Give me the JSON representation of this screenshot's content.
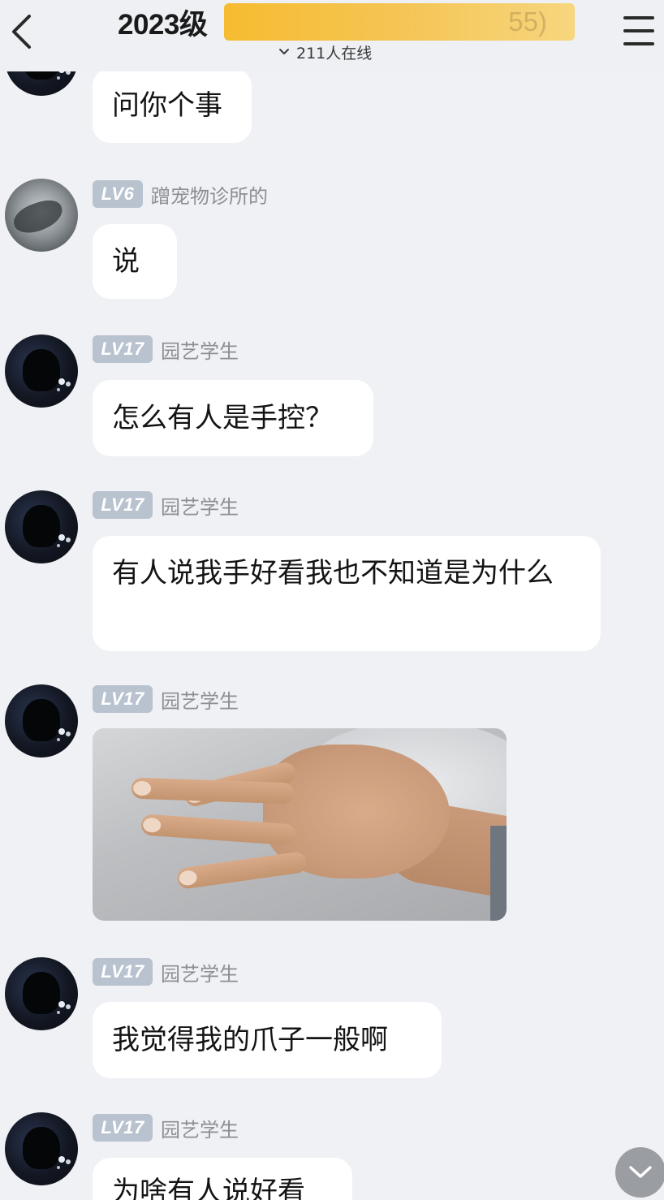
{
  "header": {
    "title": "2023级",
    "title_hidden_tail": "55)",
    "online_text": "211人在线"
  },
  "messages": [
    {
      "nick": "",
      "text": "问你个事"
    },
    {
      "level": "LV6",
      "nick": "蹭宠物诊所的",
      "text": "说"
    },
    {
      "level": "LV17",
      "nick": "园艺学生",
      "text": "怎么有人是手控？"
    },
    {
      "level": "LV17",
      "nick": "园艺学生",
      "text": "有人说我手好看我也不知道是为什么"
    },
    {
      "level": "LV17",
      "nick": "园艺学生",
      "image": "hand-photo"
    },
    {
      "level": "LV17",
      "nick": "园艺学生",
      "text": "我觉得我的爪子一般啊"
    },
    {
      "level": "LV17",
      "nick": "园艺学生",
      "text": "为啥有人说好看"
    }
  ],
  "colors": {
    "background": "#eff1f4",
    "bubble": "#ffffff",
    "level_badge": "#b9c2cf",
    "nickname": "#8b8f95",
    "title_mask": "#f7b928"
  },
  "icons": {
    "back": "chevron-left-icon",
    "menu": "hamburger-menu-icon",
    "online": "chevron-down-icon",
    "scroll": "chevron-down-icon"
  }
}
